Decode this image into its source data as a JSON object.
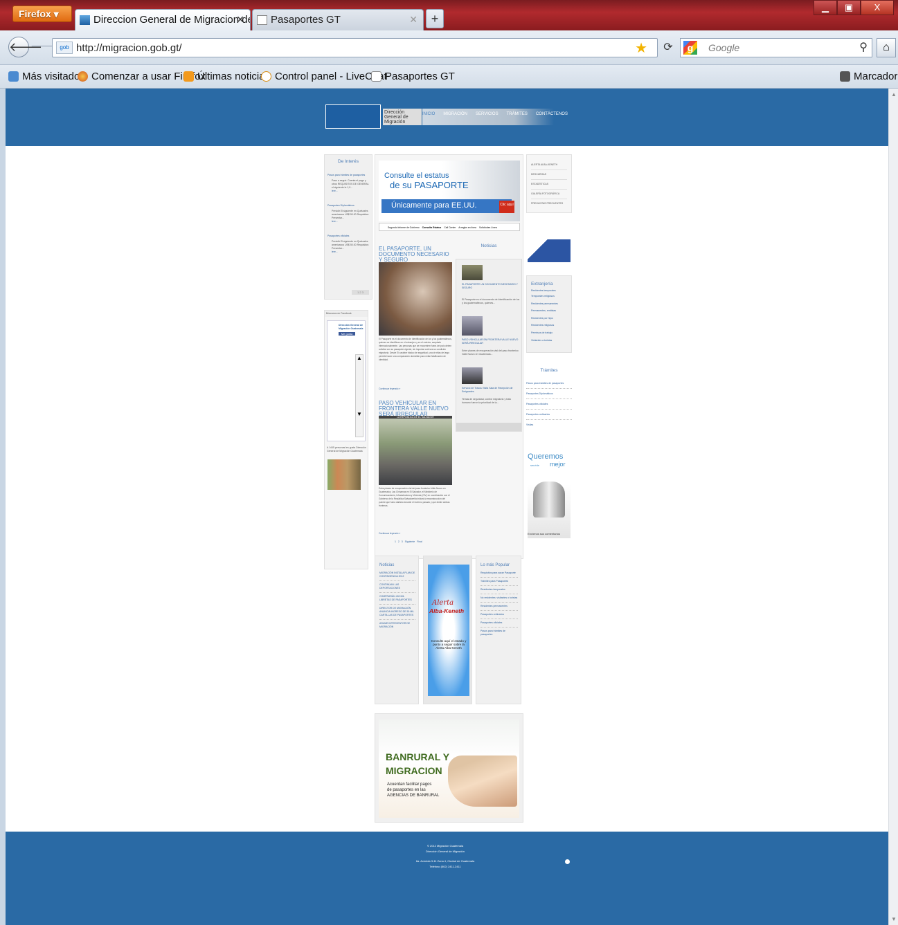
{
  "browser": {
    "app_button": "Firefox",
    "tabs": [
      {
        "title": "Direccion General de Migracion de G...",
        "active": true
      },
      {
        "title": "Pasaportes GT",
        "active": false
      }
    ],
    "url": "http://migracion.gob.gt/",
    "search_placeholder": "Google",
    "bookmarks": [
      "Más visitados",
      "Comenzar a usar Firefox",
      "Últimas noticias",
      "Control panel - LiveChat",
      "Pasaportes GT"
    ],
    "bookmarks_menu": "Marcadores"
  },
  "page": {
    "logo_title": "Dirección General de Migración",
    "topnav": [
      "INICIO",
      "MIGRACIÓN",
      "SERVICIOS",
      "TRÁMITES",
      "CONTÁCTENOS"
    ],
    "left": {
      "title": "De Interés",
      "items": [
        {
          "link": "Pasos para trámites de pasaportes",
          "desc": "Paso a seguir. Cuenta el pago y otros REQUISITOS DE GENERAL el siguiente le 1,0...",
          "more": "leer..."
        },
        {
          "link": "Pasaportes Diplomáticos",
          "desc": "Presidir El siguiente en Quetzales americanos US$ 50.00 Requisitos: Presentar...",
          "more": "leer..."
        },
        {
          "link": "Pasaportes oficiales",
          "desc": "Presidir El siguiente en Quetzales americanos US$ 50.00 Requisitos: Presentar...",
          "more": "leer..."
        }
      ],
      "pager": "1 2 3",
      "facebook_header": "Búscanos en Facebook",
      "facebook_page": "Dirección General de Migración Guatemala",
      "facebook_like": "Me gusta",
      "facebook_people": "A 1445 personas les gusta Dirección General de Migración Guatemala"
    },
    "banner": {
      "line1": "Consulte el estatus",
      "line2": "de su PASAPORTE",
      "line3": "Únicamente para EE.UU.",
      "cta": "Clic aquí",
      "tabs": [
        "Segundo Informe de Gobierno",
        "Consulta Estatus",
        "Call Center",
        "Arreglos en línea",
        "Solicitudes Línea"
      ]
    },
    "article1": {
      "title": "EL PASAPORTE, UN DOCUMENTO NECESARIO Y SEGURO",
      "body": "El Pasaporte es el documento de Identificación de los y los guatemaltecos, quienes se identifican en el extranjero y en el exterior, aceptado internacionalmente. Las personas que se encuentren fuera del país deben solicitar con su pasaporte vigente, sin importar cuál sea su condición migratoria. Desde El carácter básico de seguridad, una de ellas de largo permite hacer una comparación domiciliar para evitar falsificación de identidad.",
      "more": "Continuar leyendo »"
    },
    "article2": {
      "title": "PASO VEHICULAR EN FRONTERA VALLE NUEVO SERÁ IRREGULAR",
      "photo_caption": "LA REPÚBLICA DE EL SALVADOR",
      "body": "Entre planes de recuperación vial del paso fronterizo Valle Nuevo en Guatemala y Las Chinamas en El Salvador, el Ministerio de Comunicaciones, Infraestructura y Vivienda (CIV) en coordinación con el Gobierno de la República Salvadoreña iniciará la reconstrucción del puente que fuera dañado durante el invierno pasado y que divide ambas fronteras.",
      "more": "Continuar leyendo »",
      "pager": "1   2   3   Siguiente   Final"
    },
    "noticias": {
      "title": "Noticias",
      "items": [
        {
          "title": "EL PASAPORTE UN DOCUMENTO NECESARIO Y SEGURO",
          "desc": "El Pasaporte es el documento de Identificación de los y los guatemaltecos, quienes..."
        },
        {
          "title": "PASO VEHICULAR EN FRONTERA VALLE NUEVO SERÁ IRREGULAR",
          "desc": "Entre planes de recuperación vial del paso fronterizo Valle Nuevo en Guatemala..."
        },
        {
          "title": "Servicio de Trasus Visita Sala de Recepción de Emigrantes",
          "desc": "Temas de seguridad, control migratorio y trato humano fueron la prioridad de la..."
        }
      ]
    },
    "right": {
      "menu": [
        "ALERTA ALBA-KENETH",
        "DESCARGAS",
        "ESTADÍSTICAS",
        "GALERÍA FOTOGRÁFICA",
        "PREGUNTAS FRECUENTES"
      ],
      "extranjeria_title": "Extranjería",
      "extranjeria": [
        "Residentes temporales",
        "Temporales religiosos",
        "Residentes permanentes",
        "Permanentes, rentistas",
        "Residentes por hijos",
        "Residentes religiosos",
        "Permisos de trabajo",
        "Visitantes a turistas"
      ],
      "tramites_title": "Trámites",
      "tramites": [
        "Pasos para trámites de pasaportes",
        "Pasaportes Diplomáticos",
        "Pasaportes oficiales",
        "Pasaportes ordinarios",
        "Visitas"
      ],
      "queremos_1": "Queremos",
      "queremos_2": "servirle",
      "queremos_3": "mejor",
      "queremos_footer": "Envíenos sus comentarios"
    },
    "bottom": {
      "noticias_title": "Noticias",
      "noticias": [
        "MIGRACIÓN INSTALA PLAN DE CONTINGENCIA 2012",
        "CONTINÚAN LAS DEPORTACIONES",
        "COMPRARÁN 400 MIL LIBRETAS DE PASAPORTES",
        "DIRECTOR DE MIGRACIÓN ANUNCIA INGRESO DE 50 MIL CARTILLAS DE PASAPORTES",
        "ASUME INTERVENTOR DE MIGRACIÓN"
      ],
      "alerta_1": "Alerta",
      "alerta_2": "Alba-Keneth",
      "alerta_sub": "Consulte aquí el estado y punto a seguir sobre la Alerta Alba-Keneth",
      "popular_title": "Lo más Popular",
      "popular": [
        "Requisitos para sacar Pasaporte",
        "Trámites para Pasaportes",
        "Residentes temporales",
        "No residentes: visitantes o turistas",
        "Residentes permanentes",
        "Pasaportes ordinarios",
        "Pasaportes oficiales",
        "Pasos para trámites de pasaportes"
      ]
    },
    "banrural": {
      "line1": "BANRURAL Y",
      "line2": "MIGRACION",
      "line3": "Acuerdan facilitar pagos",
      "line4": "de pasaportes en las",
      "line5": "AGENCIAS DE BANRURAL"
    },
    "footer": {
      "line1": "© 2012 Migración Guatemala",
      "line2": "Dirección General de Migración",
      "line3": "6a. Avenida 3-11 Zona 4, Ciudad de Guatemala",
      "line4": "Teléfono (502) 2411-2411"
    }
  }
}
